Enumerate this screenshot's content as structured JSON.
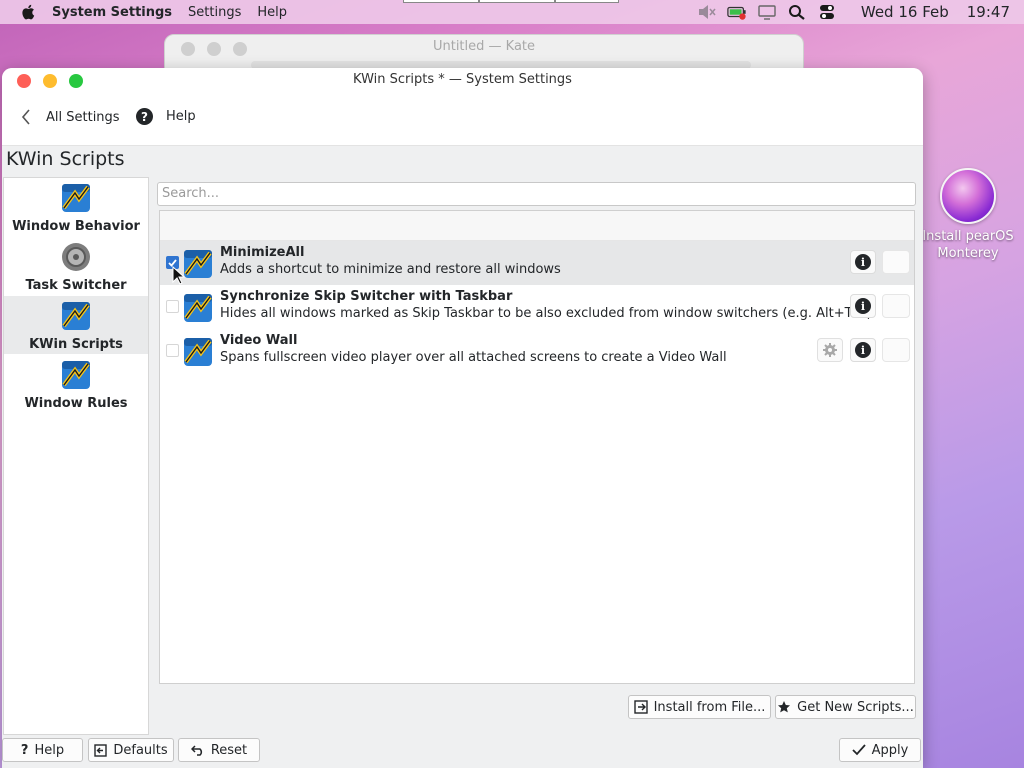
{
  "menubar": {
    "app_name": "System Settings",
    "menus": [
      "Settings",
      "Help"
    ],
    "date": "Wed 16 Feb",
    "time": "19:47"
  },
  "background_window": {
    "title": "Untitled — Kate"
  },
  "desktop_icon": {
    "label_line1": "Install pearOS",
    "label_line2": "Monterey"
  },
  "window": {
    "title": "KWin Scripts * — System Settings",
    "nav": {
      "back_label": "All Settings",
      "help_label": "Help"
    },
    "page_title": "KWin Scripts"
  },
  "sidebar": {
    "items": [
      {
        "label": "Window Behavior",
        "icon": "kwin-icon",
        "selected": false
      },
      {
        "label": "Task Switcher",
        "icon": "task-switcher-icon",
        "selected": false
      },
      {
        "label": "KWin Scripts",
        "icon": "kwin-icon",
        "selected": true
      },
      {
        "label": "Window Rules",
        "icon": "kwin-icon",
        "selected": false
      }
    ]
  },
  "search": {
    "placeholder": "Search..."
  },
  "scripts": [
    {
      "name": "MinimizeAll",
      "description": "Adds a shortcut to minimize and restore all windows",
      "enabled": true,
      "configurable": false
    },
    {
      "name": "Synchronize Skip Switcher with Taskbar",
      "description": "Hides all windows marked as Skip Taskbar to be also excluded from window switchers (e.g. Alt+Tab)",
      "enabled": false,
      "configurable": false
    },
    {
      "name": "Video Wall",
      "description": "Spans fullscreen video player over all attached screens to create a Video Wall",
      "enabled": false,
      "configurable": true
    }
  ],
  "buttons": {
    "install_from_file": "Install from File...",
    "get_new_scripts": "Get New Scripts...",
    "help": "Help",
    "defaults": "Defaults",
    "reset": "Reset",
    "apply": "Apply"
  },
  "colors": {
    "accent": "#2f74d0",
    "close": "#fe5f57",
    "minimize": "#febc2e",
    "maximize": "#28c840"
  }
}
